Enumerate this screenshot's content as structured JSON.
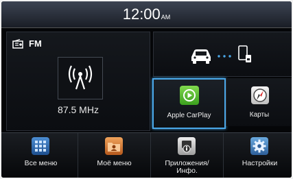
{
  "status_bar": {
    "time": "12:00",
    "ampm": "AM"
  },
  "radio": {
    "band": "FM",
    "frequency": "87.5 MHz"
  },
  "apps": {
    "carplay": {
      "label": "Apple CarPlay"
    },
    "maps": {
      "label": "Карты"
    }
  },
  "dock": [
    {
      "label": "Все меню"
    },
    {
      "label": "Моё меню"
    },
    {
      "label": "Приложения/\nИнфо."
    },
    {
      "label": "Настройки"
    }
  ],
  "colors": {
    "focus_border": "#4aa7e8",
    "carplay_green": "#5cc233"
  }
}
